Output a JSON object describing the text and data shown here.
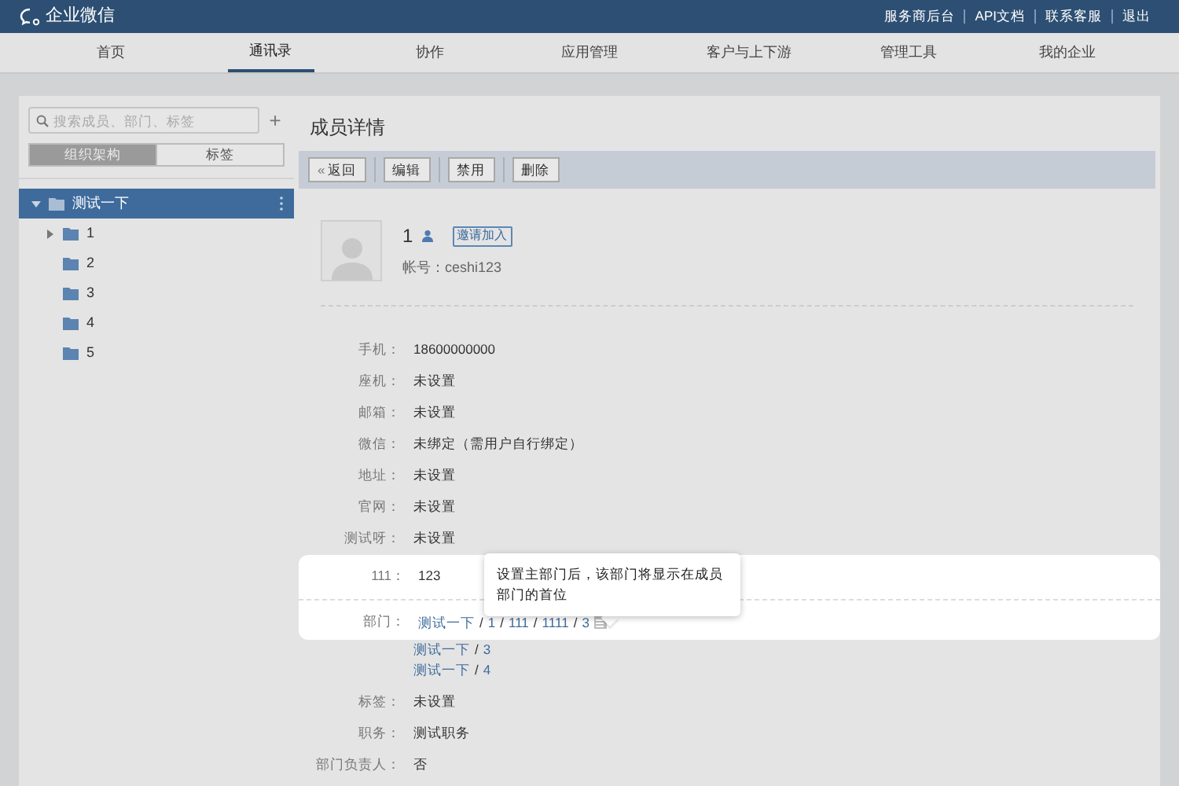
{
  "brand": {
    "name": "企业微信"
  },
  "top_links": [
    "服务商后台",
    "API文档",
    "联系客服",
    "退出"
  ],
  "nav_tabs": [
    {
      "label": "首页",
      "selected": false
    },
    {
      "label": "通讯录",
      "selected": true
    },
    {
      "label": "协作",
      "selected": false
    },
    {
      "label": "应用管理",
      "selected": false
    },
    {
      "label": "客户与上下游",
      "selected": false
    },
    {
      "label": "管理工具",
      "selected": false
    },
    {
      "label": "我的企业",
      "selected": false
    }
  ],
  "sidebar": {
    "search": {
      "placeholder": "搜索成员、部门、标签"
    },
    "add_button": "+",
    "view_tabs": [
      {
        "label": "组织架构",
        "selected": true
      },
      {
        "label": "标签",
        "selected": false
      }
    ],
    "tree": [
      {
        "label": "测试一下",
        "selected": true,
        "expanded": true,
        "children": [
          {
            "label": "1",
            "selected": false,
            "expanded": false,
            "expandable": true
          },
          {
            "label": "2",
            "selected": false,
            "expanded": false,
            "expandable": false
          },
          {
            "label": "3",
            "selected": false,
            "expanded": false,
            "expandable": false
          },
          {
            "label": "4",
            "selected": false,
            "expanded": false,
            "expandable": false
          },
          {
            "label": "5",
            "selected": false,
            "expanded": false,
            "expandable": false
          }
        ]
      }
    ]
  },
  "page_title": "成员详情",
  "toolbar": [
    {
      "label": "返回",
      "kind": "back",
      "icon": "«"
    },
    {
      "label": "编辑",
      "kind": "plain"
    },
    {
      "label": "禁用",
      "kind": "plain"
    },
    {
      "label": "删除",
      "kind": "plain"
    }
  ],
  "member": {
    "name": "1",
    "invite_button": "邀请加入",
    "account_label": "帐号：",
    "account": "ceshi123"
  },
  "details": [
    {
      "kind": "field",
      "label": "手机：",
      "value": "18600000000",
      "spotlight": false
    },
    {
      "kind": "field",
      "label": "座机：",
      "value": "未设置",
      "spotlight": false
    },
    {
      "kind": "field",
      "label": "邮箱：",
      "value": "未设置",
      "spotlight": false
    },
    {
      "kind": "field",
      "label": "微信：",
      "value": "未绑定（需用户自行绑定）",
      "spotlight": false
    },
    {
      "kind": "field",
      "label": "地址：",
      "value": "未设置",
      "spotlight": false
    },
    {
      "kind": "field",
      "label": "官网：",
      "value": "未设置",
      "spotlight": false
    },
    {
      "kind": "field",
      "label": "测试呀：",
      "value": "未设置",
      "spotlight": false
    },
    {
      "kind": "field",
      "label": "111：",
      "value": "123",
      "spotlight": true
    },
    {
      "kind": "departments",
      "label": "部门：",
      "spotlight": true,
      "separator": "/",
      "paths": [
        [
          "测试一下",
          "1",
          "111",
          "1111",
          "3"
        ],
        [
          "测试一下",
          "3"
        ],
        [
          "测试一下",
          "4"
        ]
      ]
    },
    {
      "kind": "field",
      "label": "标签：",
      "value": "未设置",
      "spotlight": false
    },
    {
      "kind": "field",
      "label": "职务：",
      "value": "测试职务",
      "spotlight": false
    },
    {
      "kind": "field",
      "label": "部门负责人：",
      "value": "否",
      "spotlight": false
    }
  ],
  "tooltip": {
    "text": "设置主部门后，该部门将显示在成员部门的首位"
  }
}
